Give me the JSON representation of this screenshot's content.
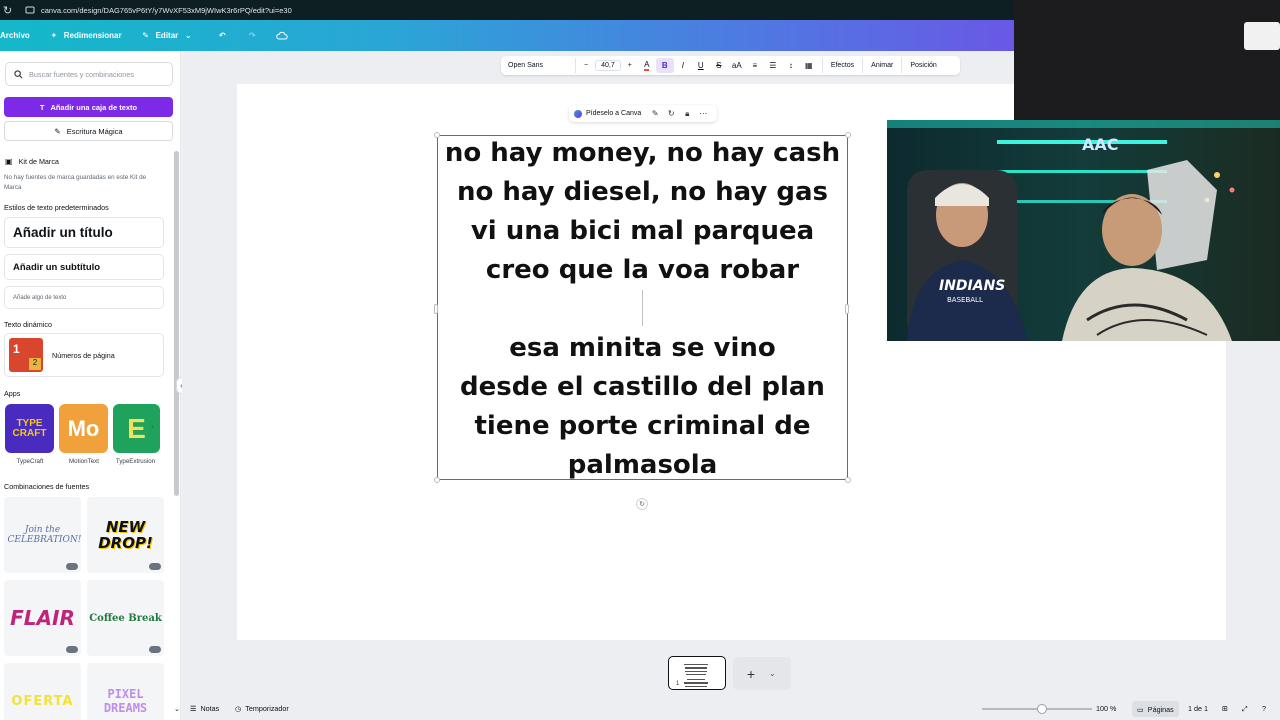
{
  "browser": {
    "url": "canva.com/design/DAG765vP6tY/y7WvXF53xM9jWIwK3r6rPQ/edit?ui=e30"
  },
  "header": {
    "file_label": "Archivo",
    "resize_label": "Redimensionar",
    "edit_label": "Editar"
  },
  "left_panel": {
    "search_placeholder": "Buscar fuentes y combinaciones",
    "add_textbox_label": "Añadir una caja de texto",
    "magic_write_label": "Escritura Mágica",
    "brand_kit_title": "Kit de Marca",
    "brand_kit_note": "No hay fuentes de marca guardadas en este Kit de Marca",
    "default_styles_title": "Estilos de texto predeterminados",
    "add_title": "Añadir un título",
    "add_subtitle": "Añadir un subtítulo",
    "add_body": "Añade algo de texto",
    "dynamic_text_title": "Texto dinámico",
    "page_numbers_label": "Números de página",
    "apps_title": "Apps",
    "apps": [
      {
        "name": "TypeCraft",
        "art": "TYPE CRAFT"
      },
      {
        "name": "MotionText",
        "art": "Mo"
      },
      {
        "name": "TypeExtrusion",
        "art": "E"
      }
    ],
    "combos_title": "Combinaciones de fuentes",
    "combos": [
      "Join the CELEBRATION!",
      "NEW DROP!",
      "FLAIR",
      "Coffee Break",
      "OFERTA",
      "PIXEL DREAMS"
    ]
  },
  "toolbar": {
    "font_name": "Open Sans",
    "minus": "−",
    "font_size": "40,7",
    "plus": "+",
    "effects_label": "Efectos",
    "animate_label": "Animar",
    "position_label": "Posición"
  },
  "context_menu": {
    "ask_canva_label": "Pídeselo a Canva"
  },
  "canvas_text": {
    "lines_top": [
      "no hay money, no hay cash",
      "no hay diesel, no hay gas",
      "vi una bici mal parquea",
      "creo que la voa robar"
    ],
    "lines_bottom": [
      "esa minita se vino",
      "desde el castillo del plan",
      "tiene porte criminal de",
      "palmasola"
    ]
  },
  "webcam": {
    "shelf_letters": "AAC",
    "shirt_text": "INDIANS BASEBALL"
  },
  "bottom_bar": {
    "notes_label": "Notas",
    "timer_label": "Temporizador",
    "zoom": "100 %",
    "pages_label": "Páginas",
    "page_count": "1 de 1",
    "thumb_page": "1"
  },
  "colors": {
    "brand_purple": "#7d2ae8",
    "selection": "#8b3dff"
  }
}
